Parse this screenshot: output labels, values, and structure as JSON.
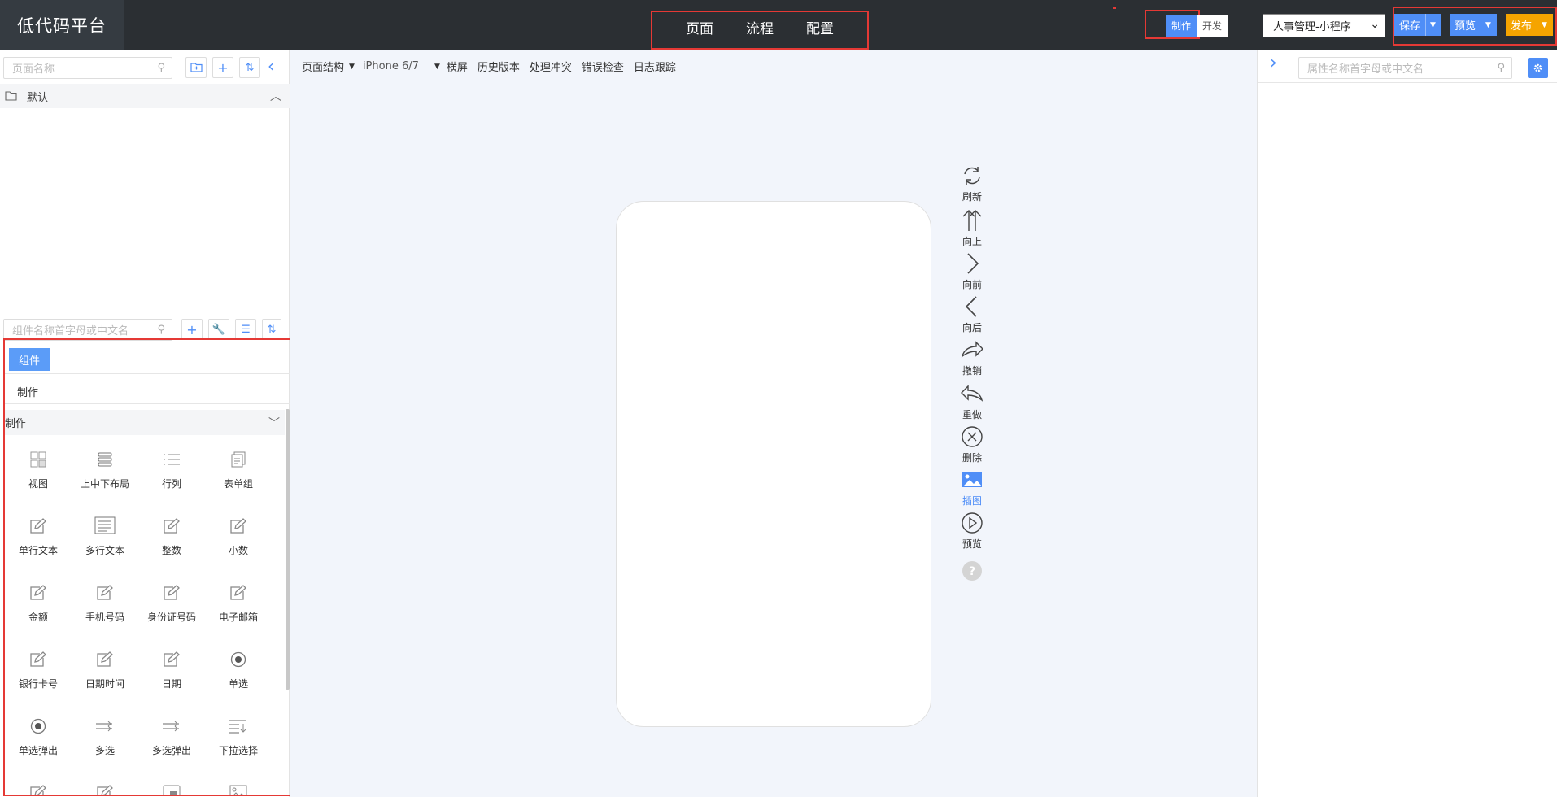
{
  "app": {
    "title": "低代码平台"
  },
  "nav": {
    "items": [
      "页面",
      "流程",
      "配置"
    ],
    "active": "页面"
  },
  "mode": {
    "make": "制作",
    "dev": "开发"
  },
  "app_select": {
    "value": "人事管理-小程序"
  },
  "actions": {
    "save": "保存",
    "preview": "预览",
    "publish": "发布"
  },
  "colors": {
    "accent": "#4f8ef7",
    "publish": "#f5a400",
    "highlight": "#e53935",
    "topbar": "#2b2f33"
  },
  "left": {
    "page_search": {
      "placeholder": "页面名称"
    },
    "folder": {
      "name": "默认"
    },
    "comp_search": {
      "placeholder": "组件名称首字母或中文名"
    },
    "comp_tab": "组件",
    "comp_sub": "制作",
    "category": "制作",
    "components": [
      {
        "label": "视图",
        "icon": "view-icon"
      },
      {
        "label": "上中下布局",
        "icon": "stack-layout-icon"
      },
      {
        "label": "行列",
        "icon": "rows-icon"
      },
      {
        "label": "表单组",
        "icon": "form-group-icon"
      },
      {
        "label": "单行文本",
        "icon": "edit-icon"
      },
      {
        "label": "多行文本",
        "icon": "textarea-icon"
      },
      {
        "label": "整数",
        "icon": "edit-icon"
      },
      {
        "label": "小数",
        "icon": "edit-icon"
      },
      {
        "label": "金额",
        "icon": "edit-icon"
      },
      {
        "label": "手机号码",
        "icon": "edit-icon"
      },
      {
        "label": "身份证号码",
        "icon": "edit-icon"
      },
      {
        "label": "电子邮箱",
        "icon": "edit-icon"
      },
      {
        "label": "银行卡号",
        "icon": "edit-icon"
      },
      {
        "label": "日期时间",
        "icon": "edit-icon"
      },
      {
        "label": "日期",
        "icon": "edit-icon"
      },
      {
        "label": "单选",
        "icon": "radio-icon"
      },
      {
        "label": "单选弹出",
        "icon": "radio-icon"
      },
      {
        "label": "多选",
        "icon": "checklist-icon"
      },
      {
        "label": "多选弹出",
        "icon": "checklist-icon"
      },
      {
        "label": "下拉选择",
        "icon": "dropdown-list-icon"
      },
      {
        "label": "",
        "icon": "edit-icon"
      },
      {
        "label": "",
        "icon": "edit-icon"
      },
      {
        "label": "",
        "icon": "image-frame-icon"
      },
      {
        "label": "",
        "icon": "picture-icon"
      }
    ]
  },
  "toolbar": {
    "structure": "页面结构",
    "device": "iPhone 6/7",
    "landscape": "横屏",
    "history": "历史版本",
    "conflict": "处理冲突",
    "error_check": "错误检查",
    "log": "日志跟踪"
  },
  "side_actions": [
    {
      "label": "刷新",
      "icon": "refresh-icon"
    },
    {
      "label": "向上",
      "icon": "arrow-up-icon"
    },
    {
      "label": "向前",
      "icon": "chevron-right-icon"
    },
    {
      "label": "向后",
      "icon": "chevron-left-icon"
    },
    {
      "label": "撤销",
      "icon": "undo-icon"
    },
    {
      "label": "重做",
      "icon": "redo-icon"
    },
    {
      "label": "删除",
      "icon": "delete-icon"
    },
    {
      "label": "插图",
      "icon": "image-icon"
    },
    {
      "label": "预览",
      "icon": "play-icon"
    },
    {
      "label": "",
      "icon": "help-icon"
    }
  ],
  "right": {
    "search": {
      "placeholder": "属性名称首字母或中文名"
    }
  }
}
